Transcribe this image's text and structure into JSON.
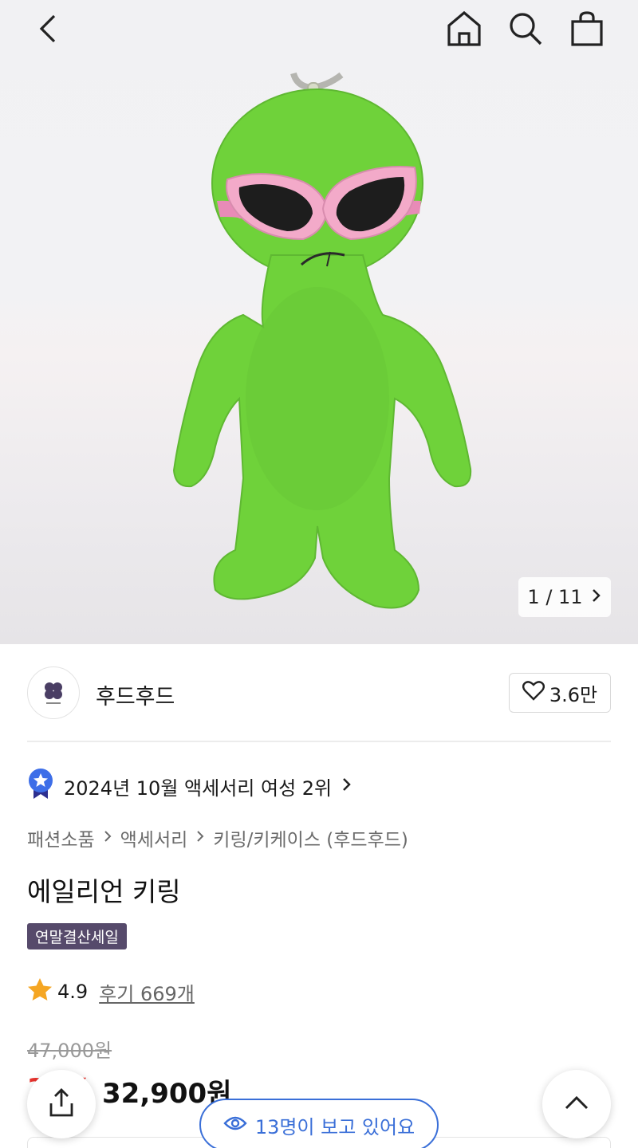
{
  "header": {
    "back_icon": "chevron-left-icon",
    "home_icon": "home-icon",
    "search_icon": "search-icon",
    "cart_icon": "shopping-bag-icon"
  },
  "gallery": {
    "counter": "1 / 11",
    "current": 1,
    "total": 11
  },
  "brand": {
    "name": "후드후드",
    "like_count": "3.6만"
  },
  "ranking": {
    "text": "2024년 10월 액세서리 여성 2위"
  },
  "breadcrumb": [
    "패션소품",
    "액세서리",
    "키링/키케이스 (후드후드)"
  ],
  "product": {
    "title": "에일리언 키링",
    "badge": "연말결산세일",
    "rating": "4.9",
    "reviews": "후기 669개",
    "original_price": "47,000원",
    "discount_rate": "30%",
    "price": "32,900원"
  },
  "viewers": {
    "text": "13명이 보고 있어요"
  },
  "colors": {
    "accent_blue": "#3a6fd8",
    "badge_purple": "#564a6b",
    "sale_red": "#e8322d",
    "star_orange": "#f5a623",
    "alien_green": "#6fd23a"
  }
}
